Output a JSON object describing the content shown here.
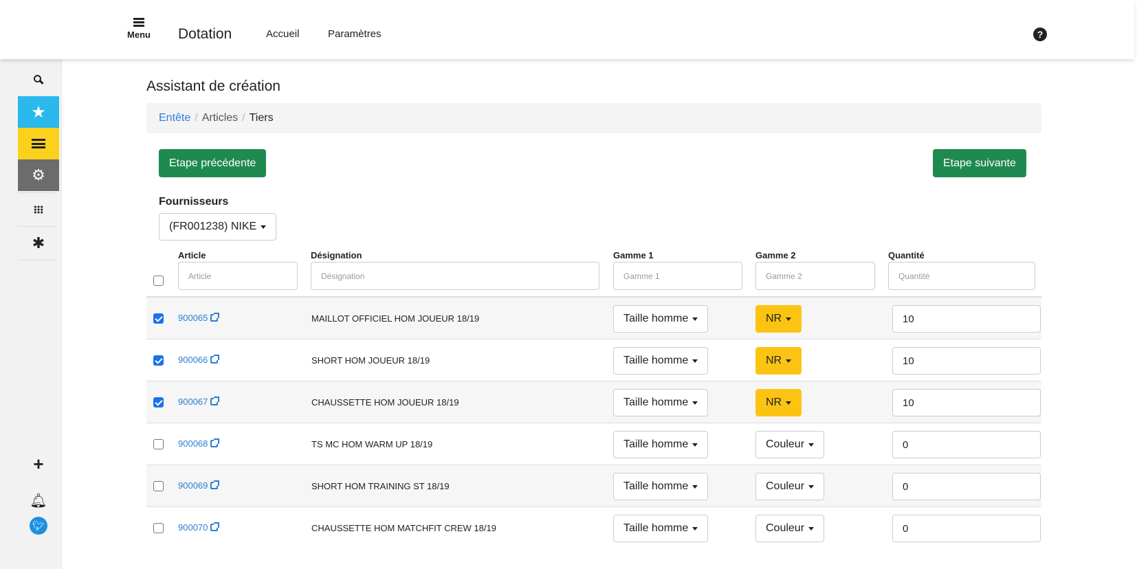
{
  "header": {
    "menu_label": "Menu",
    "brand": "Dotation",
    "nav": [
      {
        "label": "Accueil"
      },
      {
        "label": "Paramètres"
      }
    ]
  },
  "sidebar": {
    "icons": [
      "search-icon",
      "star-icon",
      "list-icon",
      "gear-icon",
      "grid-icon",
      "asterisk-icon",
      "plus-icon",
      "bell-icon",
      "twitter-icon"
    ],
    "colors": {
      "star_bg": "#2bb8ec",
      "list_bg": "#fcd11e",
      "gear_bg": "#6c6c6c"
    }
  },
  "page": {
    "title": "Assistant de création",
    "breadcrumb": {
      "first": "Entête",
      "second": "Articles",
      "current": "Tiers"
    },
    "prev_button": "Etape précédente",
    "next_button": "Etape suivante",
    "suppliers_label": "Fournisseurs",
    "supplier_selected": "(FR001238) NIKE"
  },
  "table": {
    "columns": {
      "article": "Article",
      "designation": "Désignation",
      "gamme1": "Gamme 1",
      "gamme2": "Gamme 2",
      "quantite": "Quantité"
    },
    "filters": {
      "article": "Article",
      "designation": "Désignation",
      "gamme1": "Gamme 1",
      "gamme2": "Gamme 2",
      "quantite": "Quantité"
    },
    "rows": [
      {
        "checked": true,
        "article": "900065",
        "designation": "MAILLOT OFFICIEL HOM JOUEUR 18/19",
        "gamme1": "Taille homme",
        "gamme2": "NR",
        "quantite": "10"
      },
      {
        "checked": true,
        "article": "900066",
        "designation": "SHORT HOM JOUEUR 18/19",
        "gamme1": "Taille homme",
        "gamme2": "NR",
        "quantite": "10"
      },
      {
        "checked": true,
        "article": "900067",
        "designation": "CHAUSSETTE HOM JOUEUR 18/19",
        "gamme1": "Taille homme",
        "gamme2": "NR",
        "quantite": "10"
      },
      {
        "checked": false,
        "article": "900068",
        "designation": "TS MC HOM WARM UP 18/19",
        "gamme1": "Taille homme",
        "gamme2": "Couleur",
        "quantite": "0"
      },
      {
        "checked": false,
        "article": "900069",
        "designation": "SHORT HOM TRAINING ST 18/19",
        "gamme1": "Taille homme",
        "gamme2": "Couleur",
        "quantite": "0"
      },
      {
        "checked": false,
        "article": "900070",
        "designation": "CHAUSSETTE HOM MATCHFIT CREW 18/19",
        "gamme1": "Taille homme",
        "gamme2": "Couleur",
        "quantite": "0"
      }
    ]
  },
  "colors": {
    "accent_green": "#1f8a4f",
    "link_blue": "#2a7fd4",
    "highlight_yellow": "#fcc412"
  }
}
